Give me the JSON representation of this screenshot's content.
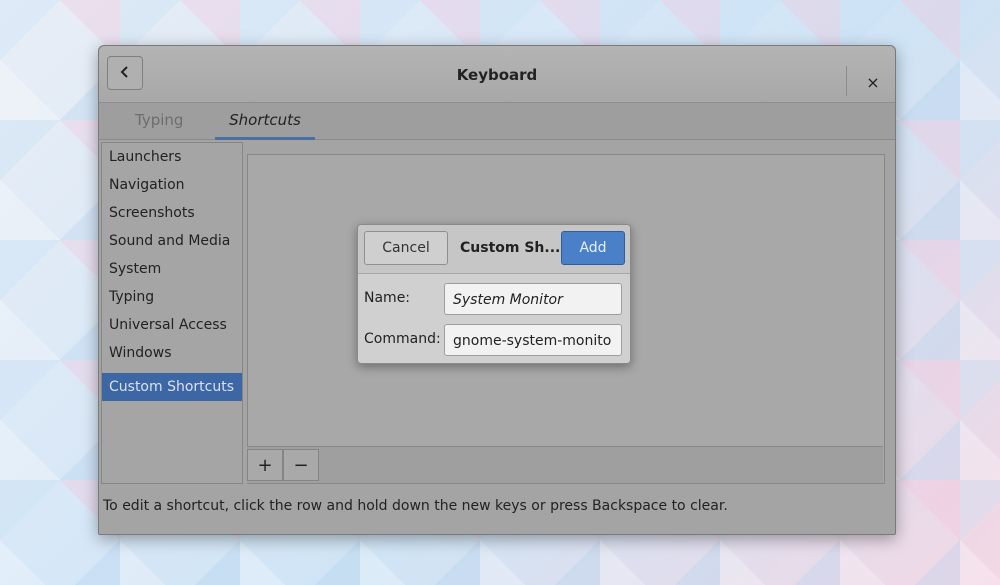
{
  "window": {
    "title": "Keyboard",
    "close_glyph": "×",
    "back_glyph": "‹"
  },
  "tabs": [
    {
      "label": "Typing",
      "active": false
    },
    {
      "label": "Shortcuts",
      "active": true
    }
  ],
  "sidebar": {
    "items": [
      {
        "label": "Launchers"
      },
      {
        "label": "Navigation"
      },
      {
        "label": "Screenshots"
      },
      {
        "label": "Sound and Media"
      },
      {
        "label": "System"
      },
      {
        "label": "Typing"
      },
      {
        "label": "Universal Access"
      },
      {
        "label": "Windows"
      },
      {
        "label": "Custom Shortcuts",
        "selected": true
      }
    ]
  },
  "toolbar": {
    "add_glyph": "+",
    "remove_glyph": "−"
  },
  "footer": {
    "hint": "To edit a shortcut, click the row and hold down the new keys or press Backspace to clear."
  },
  "dialog": {
    "cancel_label": "Cancel",
    "title": "Custom Sh...",
    "add_label": "Add",
    "name_label": "Name:",
    "name_value": "System Monitor",
    "command_label": "Command:",
    "command_value": "gnome-system-monito"
  },
  "colors": {
    "accent": "#3d66a4",
    "add_button": "#4a80c8"
  }
}
